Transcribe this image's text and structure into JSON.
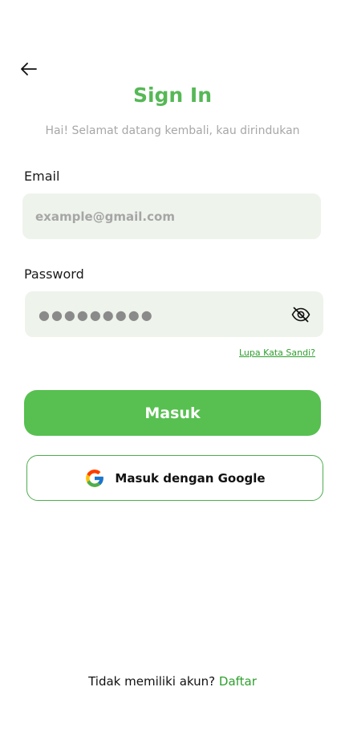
{
  "header": {
    "back_icon": "arrow-left-icon",
    "title": "Sign In",
    "subtitle": "Hai! Selamat datang kembali, kau dirindukan"
  },
  "form": {
    "email_label": "Email",
    "email_placeholder": "example@gmail.com",
    "password_label": "Password",
    "password_masked": "●●●●●●●●●",
    "toggle_visibility_icon": "eye-off-icon",
    "forgot_password": "Lupa Kata Sandi?"
  },
  "actions": {
    "sign_in_label": "Masuk",
    "google_label": "Masuk dengan Google",
    "google_icon": "google-icon"
  },
  "footer": {
    "prompt": "Tidak memiliki akun?",
    "register_link": "Daftar"
  },
  "colors": {
    "brand_green": "#57c050",
    "title_green": "#56b856",
    "link_green": "#2f9e2f",
    "field_background": "#eef3ec",
    "subtitle_gray": "#a7a7a7"
  }
}
